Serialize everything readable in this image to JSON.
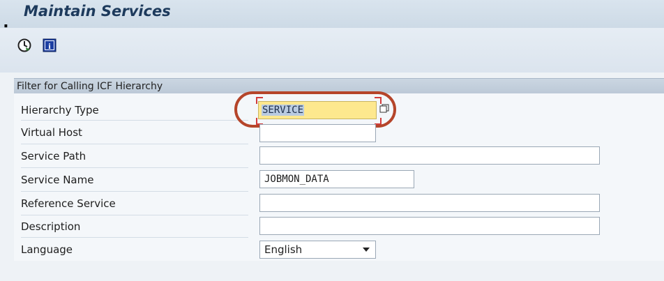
{
  "window": {
    "title": "Maintain Services",
    "colon": ":"
  },
  "toolbar": {
    "execute_icon": "execute-clock-icon",
    "info_icon": "info-icon",
    "info_glyph": "i"
  },
  "filter": {
    "section_title": "Filter for Calling ICF Hierarchy",
    "rows": [
      {
        "label": "Hierarchy Type",
        "value": "SERVICE"
      },
      {
        "label": "Virtual Host",
        "value": ""
      },
      {
        "label": "Service Path",
        "value": ""
      },
      {
        "label": "Service Name",
        "value": "JOBMON_DATA"
      },
      {
        "label": "Reference Service",
        "value": ""
      },
      {
        "label": "Description",
        "value": ""
      },
      {
        "label": "Language",
        "value": "English"
      }
    ]
  },
  "colors": {
    "highlight_field": "#fde88e",
    "annotation_oval": "#b5452a",
    "title_text": "#1d3a5c"
  }
}
